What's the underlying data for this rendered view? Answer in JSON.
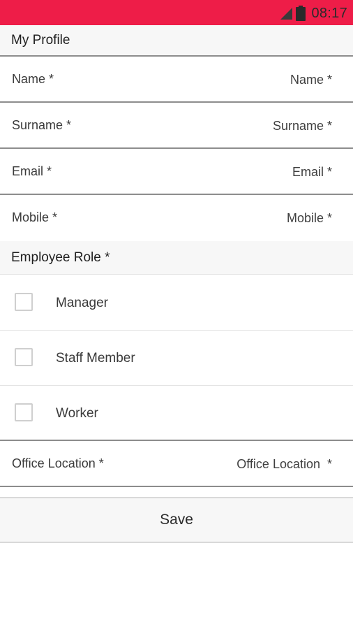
{
  "status_bar": {
    "time": "08:17",
    "color": "#ee1d48"
  },
  "profile": {
    "title": "My Profile",
    "fields": [
      {
        "label": "Name *",
        "placeholder": "Name *"
      },
      {
        "label": "Surname *",
        "placeholder": "Surname *"
      },
      {
        "label": "Email *",
        "placeholder": "Email *"
      },
      {
        "label": "Mobile *",
        "placeholder": "Mobile *"
      }
    ]
  },
  "employee_role": {
    "title": "Employee Role *",
    "options": [
      {
        "label": "Manager",
        "checked": false
      },
      {
        "label": "Staff Member",
        "checked": false
      },
      {
        "label": "Worker",
        "checked": false
      }
    ]
  },
  "office_location": {
    "label": "Office Location *",
    "placeholder": "Office Location  *"
  },
  "save_button": {
    "label": "Save"
  }
}
